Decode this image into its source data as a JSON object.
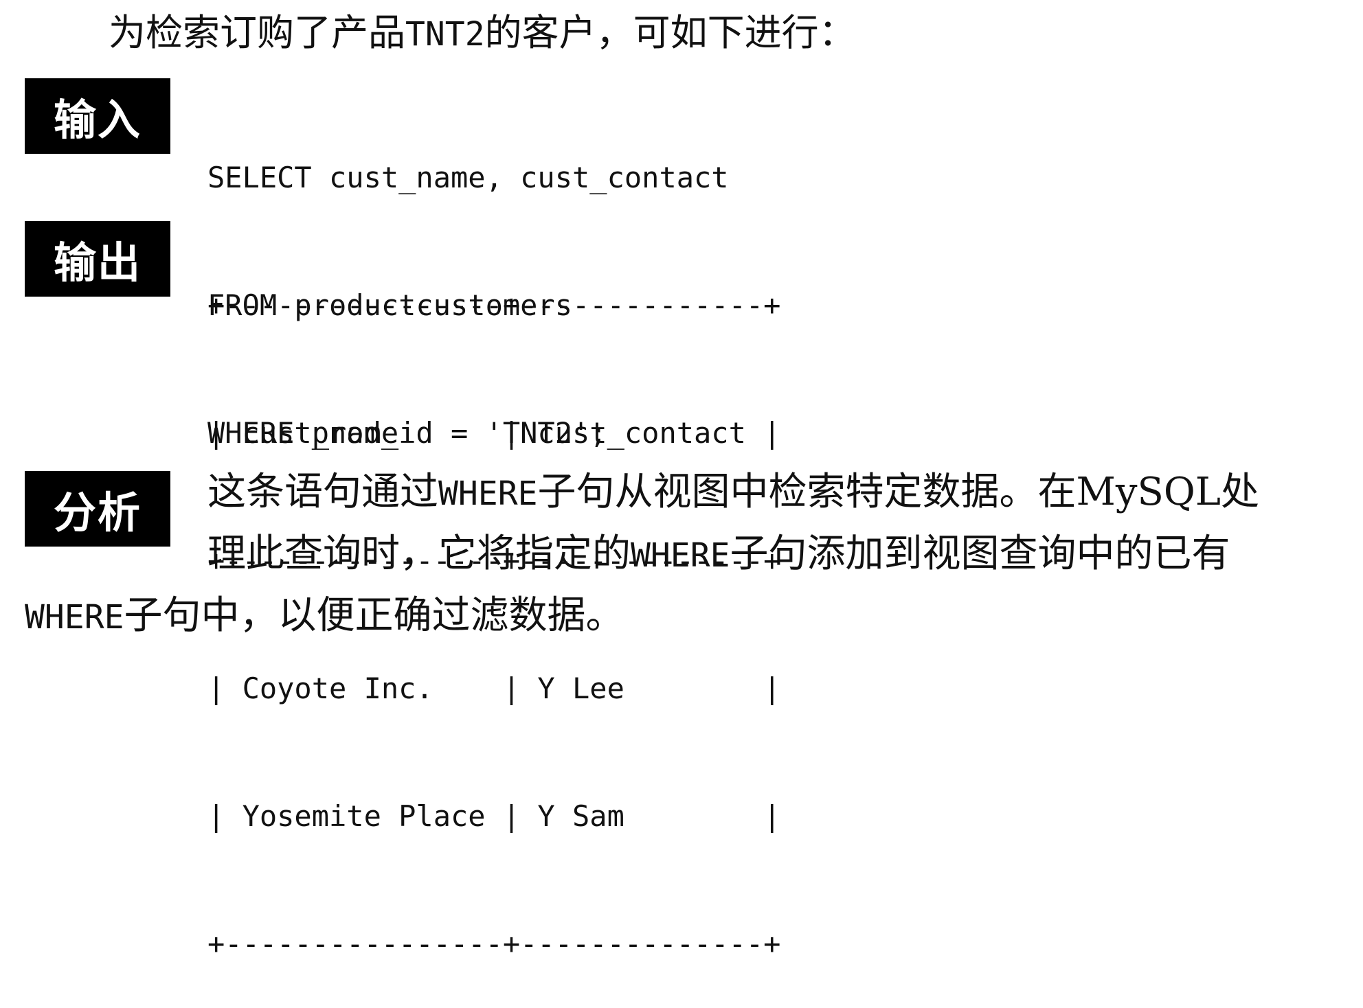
{
  "intro": {
    "before": "为检索订购了产品",
    "code": "TNT2",
    "after": "的客户，可如下进行："
  },
  "labels": {
    "input": "输入",
    "output": "输出",
    "analysis": "分析"
  },
  "input_code": [
    "SELECT cust_name, cust_contact",
    "FROM productcustomers",
    "WHERE prod_id = 'TNT2';"
  ],
  "output_table": {
    "border": "+----------------+--------------+",
    "header": "| cust_name      | cust_contact |",
    "rows": [
      "| Coyote Inc.    | Y Lee        |",
      "| Yosemite Place | Y Sam        |"
    ]
  },
  "analysis": {
    "line1_a": "这条语句通过",
    "line1_code": "WHERE",
    "line1_b": "子句从视图中检索特定数据。在MySQL处",
    "line2_a": "理此查询时，它将指定的",
    "line2_code": "WHERE",
    "line2_b": "子句添加到视图查询中的已有",
    "line3_code": "WHERE",
    "line3_b": "子句中，以便正确过滤数据。"
  }
}
